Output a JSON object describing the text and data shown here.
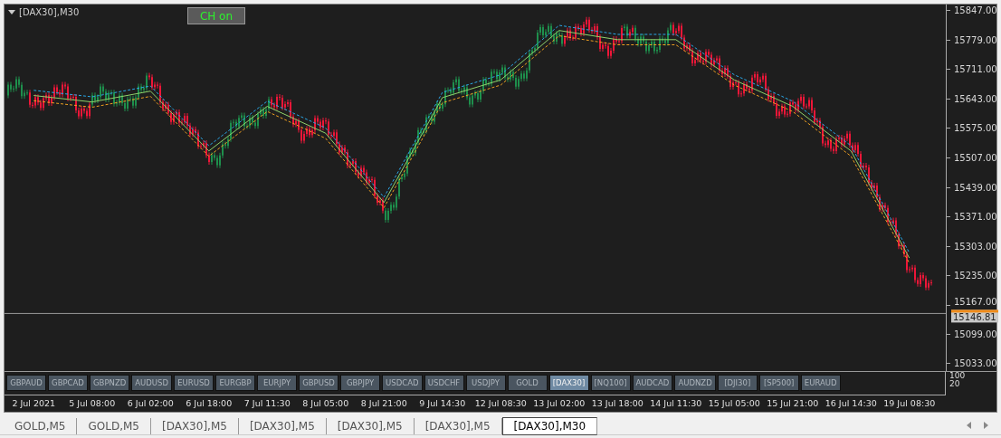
{
  "chart": {
    "title": "[DAX30],M30",
    "toggle_button": "CH on",
    "last_price": "15146.81",
    "chart_data": {
      "type": "line",
      "categories": [
        "2 Jul 2021",
        "5 Jul 08:00",
        "6 Jul 02:00",
        "6 Jul 18:00",
        "7 Jul 11:30",
        "8 Jul 05:00",
        "8 Jul 21:00",
        "9 Jul 14:30",
        "12 Jul 08:30",
        "13 Jul 02:00",
        "13 Jul 18:00",
        "14 Jul 11:30",
        "15 Jul 05:00",
        "15 Jul 21:00",
        "16 Jul 14:30",
        "19 Jul 08:30"
      ],
      "series": [
        {
          "color": "#2aa7e8",
          "line_style": "dashed",
          "values": [
            15662,
            15647,
            15672,
            15534,
            15637,
            15575,
            15415,
            15657,
            15698,
            15812,
            15791,
            15791,
            15698,
            15637,
            15534,
            15287
          ]
        },
        {
          "color": "#8fd16a",
          "line_style": "solid",
          "values": [
            15650,
            15635,
            15660,
            15522,
            15625,
            15563,
            15403,
            15645,
            15686,
            15800,
            15779,
            15779,
            15686,
            15625,
            15522,
            15275
          ]
        },
        {
          "color": "#f0a020",
          "line_style": "dashed",
          "values": [
            15638,
            15623,
            15648,
            15510,
            15613,
            15551,
            15391,
            15633,
            15674,
            15788,
            15767,
            15767,
            15674,
            15613,
            15510,
            15263
          ]
        }
      ],
      "ref_lines": [
        {
          "axis": "y",
          "value": 15146.81
        }
      ],
      "ylim": [
        15014,
        15860
      ],
      "yticks": [
        {
          "value": 15847,
          "label": "15847.00"
        },
        {
          "value": 15779,
          "label": "15779.00"
        },
        {
          "value": 15711,
          "label": "15711.00"
        },
        {
          "value": 15643,
          "label": "15643.00"
        },
        {
          "value": 15575,
          "label": "15575.00"
        },
        {
          "value": 15507,
          "label": "15507.00"
        },
        {
          "value": 15439,
          "label": "15439.00"
        },
        {
          "value": 15371,
          "label": "15371.00"
        },
        {
          "value": 15303,
          "label": "15303.00"
        },
        {
          "value": 15235,
          "label": "15235.00"
        },
        {
          "value": 15167,
          "label": "15167.00"
        },
        {
          "value": 15099,
          "label": "15099.00"
        },
        {
          "value": 15033,
          "label": "15033.00"
        }
      ]
    }
  },
  "indicator_pane": {
    "scale_labels": [
      "100",
      "20"
    ],
    "symbol_buttons": [
      {
        "label": "GBPAUD",
        "selected": false
      },
      {
        "label": "GBPCAD",
        "selected": false
      },
      {
        "label": "GBPNZD",
        "selected": false
      },
      {
        "label": "AUDUSD",
        "selected": false
      },
      {
        "label": "EURUSD",
        "selected": false
      },
      {
        "label": "EURGBP",
        "selected": false
      },
      {
        "label": "EURJPY",
        "selected": false
      },
      {
        "label": "GBPUSD",
        "selected": false
      },
      {
        "label": "GBPJPY",
        "selected": false
      },
      {
        "label": "USDCAD",
        "selected": false
      },
      {
        "label": "USDCHF",
        "selected": false
      },
      {
        "label": "USDJPY",
        "selected": false
      },
      {
        "label": "GOLD",
        "selected": false
      },
      {
        "label": "[DAX30]",
        "selected": true
      },
      {
        "label": "[NQ100]",
        "selected": false
      },
      {
        "label": "AUDCAD",
        "selected": false
      },
      {
        "label": "AUDNZD",
        "selected": false
      },
      {
        "label": "[DJI30]",
        "selected": false
      },
      {
        "label": "[SP500]",
        "selected": false
      },
      {
        "label": "EURAUD",
        "selected": false
      }
    ]
  },
  "tabs": [
    {
      "label": "GOLD,M5",
      "selected": false
    },
    {
      "label": "GOLD,M5",
      "selected": false
    },
    {
      "label": "[DAX30],M5",
      "selected": false
    },
    {
      "label": "[DAX30],M5",
      "selected": false
    },
    {
      "label": "[DAX30],M5",
      "selected": false
    },
    {
      "label": "[DAX30],M5",
      "selected": false
    },
    {
      "label": "[DAX30],M30",
      "selected": true
    }
  ]
}
